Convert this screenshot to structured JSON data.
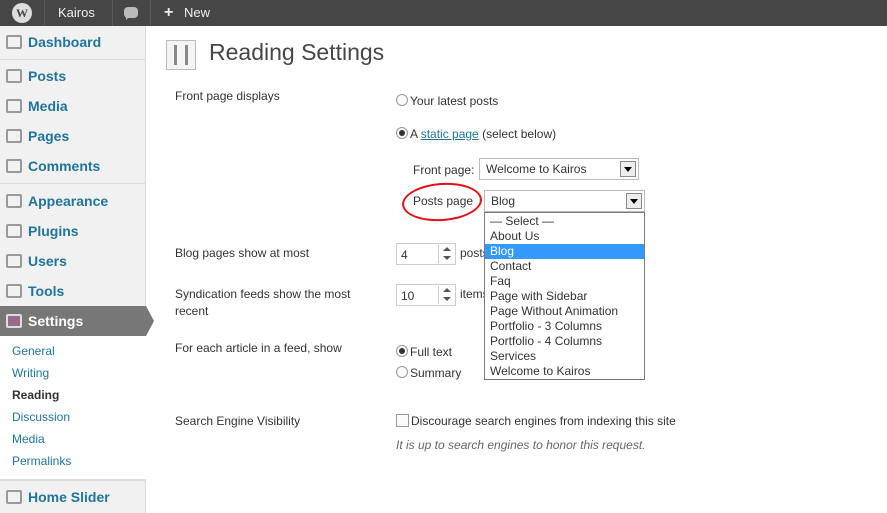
{
  "adminbar": {
    "logo": "wordpress-logo-icon",
    "site_name": "Kairos",
    "comments_icon": "comment-bubble-icon",
    "new_plus": "+",
    "new_label": "New"
  },
  "sidebar": {
    "items": [
      {
        "label": "Dashboard",
        "icon": "dashboard-icon"
      },
      {
        "label": "Posts",
        "icon": "pin-icon"
      },
      {
        "label": "Media",
        "icon": "media-icon"
      },
      {
        "label": "Pages",
        "icon": "pages-icon"
      },
      {
        "label": "Comments",
        "icon": "comments-icon"
      },
      {
        "label": "Appearance",
        "icon": "appearance-icon"
      },
      {
        "label": "Plugins",
        "icon": "plugins-icon"
      },
      {
        "label": "Users",
        "icon": "users-icon"
      },
      {
        "label": "Tools",
        "icon": "tools-icon"
      },
      {
        "label": "Settings",
        "icon": "settings-icon"
      },
      {
        "label": "Home Slider",
        "icon": "slider-icon"
      }
    ],
    "submenu": [
      "General",
      "Writing",
      "Reading",
      "Discussion",
      "Media",
      "Permalinks"
    ],
    "current_sub": "Reading"
  },
  "page": {
    "title": "Reading Settings",
    "front_page_displays": {
      "label": "Front page displays",
      "option_latest": "Your latest posts",
      "option_static_prefix": "A",
      "option_static_link": "static page",
      "option_static_suffix": "(select below)",
      "selected": "static page"
    },
    "front_page": {
      "label": "Front page:",
      "value": "Welcome to Kairos"
    },
    "posts_page": {
      "label": "Posts page",
      "value": "Blog",
      "options": [
        "— Select —",
        "About Us",
        "Blog",
        "Contact",
        "Faq",
        "Page with Sidebar",
        "Page Without Animation",
        "Portfolio - 3 Columns",
        "Portfolio - 4 Columns",
        "Services",
        "Welcome to Kairos"
      ],
      "highlighted": "Blog"
    },
    "blog_pages": {
      "label": "Blog pages show at most",
      "value": "4",
      "unit": "posts"
    },
    "syndication": {
      "label_line1": "Syndication feeds show the most",
      "label_line2": "recent",
      "value": "10",
      "unit": "items"
    },
    "feed_article": {
      "label": "For each article in a feed, show",
      "option_full": "Full text",
      "option_summary": "Summary",
      "selected": "Full text"
    },
    "search_engine": {
      "label": "Search Engine Visibility",
      "checkbox_label": "Discourage search engines from indexing this site",
      "checked": false,
      "description": "It is up to search engines to honor this request."
    }
  },
  "colors": {
    "adminbar": "#464646",
    "link": "#21759b",
    "highlight": "#3399ff",
    "annotation": "#e0101a"
  }
}
